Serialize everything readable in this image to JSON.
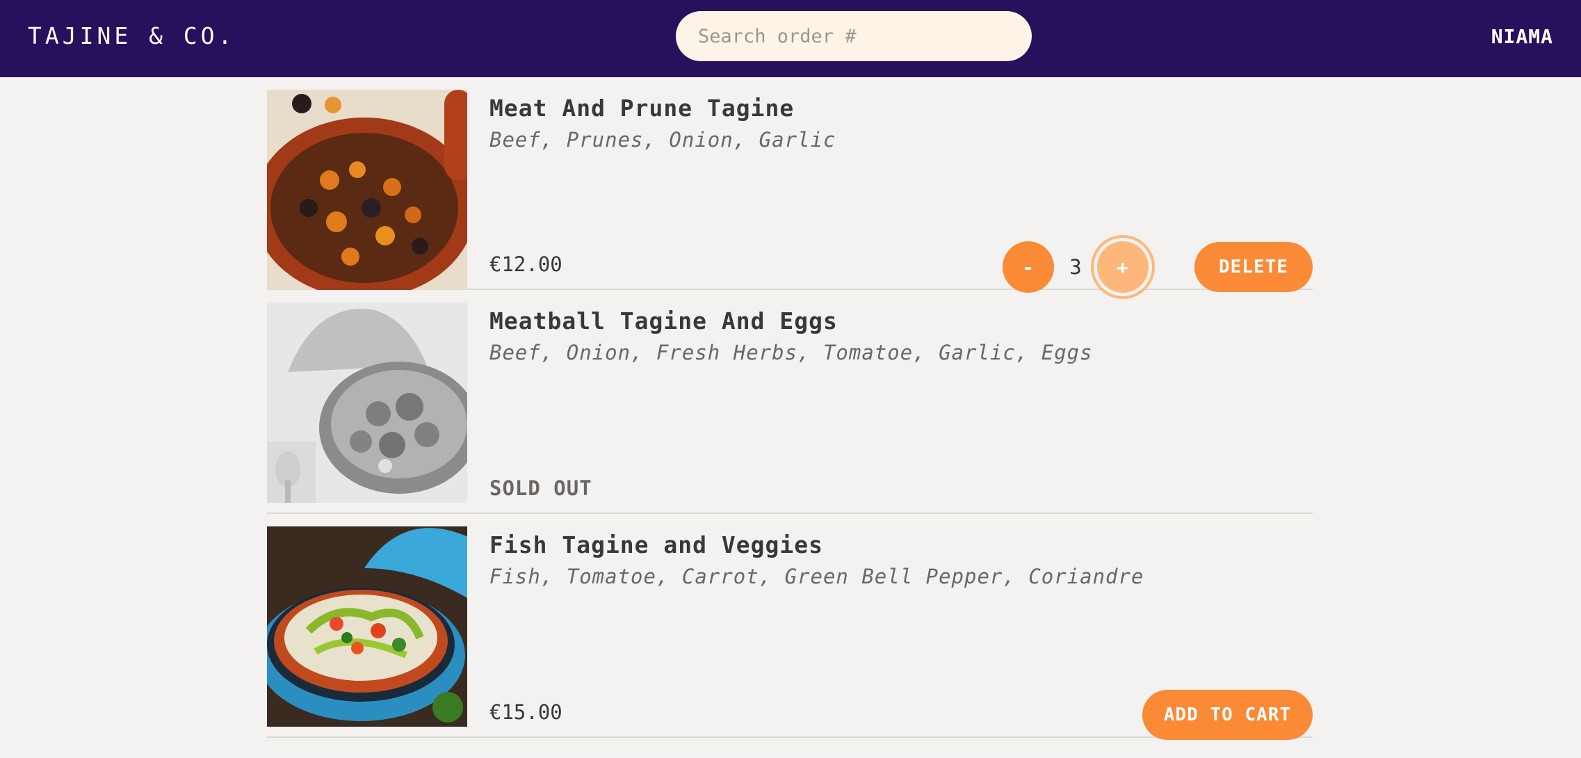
{
  "header": {
    "logo": "TAJINE & CO.",
    "search_placeholder": "Search order #",
    "user": "NIAMA"
  },
  "menu": {
    "items": [
      {
        "name": "Meat And Prune Tagine",
        "ingredients": "Beef, Prunes, Onion, Garlic",
        "price": "€12.00",
        "status": "in_cart",
        "quantity": "3",
        "decrease_label": "-",
        "increase_label": "+",
        "delete_label": "DELETE"
      },
      {
        "name": "Meatball Tagine And Eggs",
        "ingredients": "Beef, Onion, Fresh Herbs, Tomatoe, Garlic, Eggs",
        "status": "sold_out",
        "sold_out_label": "SOLD OUT"
      },
      {
        "name": "Fish Tagine and Veggies",
        "ingredients": "Fish, Tomatoe, Carrot, Green Bell Pepper, Coriandre",
        "price": "€15.00",
        "status": "available",
        "add_label": "ADD TO CART"
      }
    ]
  },
  "colors": {
    "header_bg": "#27105c",
    "accent": "#fa8a36",
    "page_bg": "#f3f2f0",
    "search_bg": "#fdf3e6"
  }
}
